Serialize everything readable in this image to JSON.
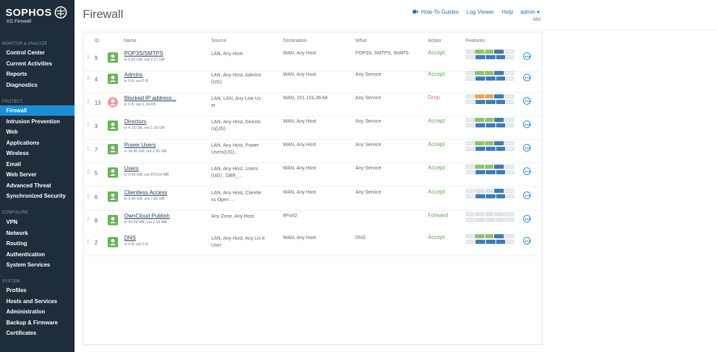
{
  "brand": {
    "name": "SOPHOS",
    "product": "XG Firewall"
  },
  "sidebar": {
    "sections": [
      {
        "title": "MONITOR & ANALYZE",
        "items": [
          "Control Center",
          "Current Activities",
          "Reports",
          "Diagnostics"
        ]
      },
      {
        "title": "PROTECT",
        "items": [
          "Firewall",
          "Intrusion Prevention",
          "Web",
          "Applications",
          "Wireless",
          "Email",
          "Web Server",
          "Advanced Threat",
          "Synchronized Security"
        ]
      },
      {
        "title": "CONFIGURE",
        "items": [
          "VPN",
          "Network",
          "Routing",
          "Authentication",
          "System Services"
        ]
      },
      {
        "title": "SYSTEM",
        "items": [
          "Profiles",
          "Hosts and Services",
          "Administration",
          "Backup & Firmware",
          "Certificates"
        ]
      }
    ],
    "active": "Firewall"
  },
  "header": {
    "title": "Firewall",
    "howto": "How-To Guides",
    "logviewer": "Log Viewer",
    "help": "Help",
    "admin": "admin ▾",
    "admin_sub": "Alsi"
  },
  "table": {
    "columns": {
      "id": "ID",
      "name": "Name",
      "source": "Source",
      "destination": "Destination",
      "what": "What",
      "action": "Action",
      "features": "Features"
    },
    "rows": [
      {
        "id": "9",
        "name": "POP3S/SMTPS",
        "sub": "in 5.81 GB, out 2.27 GB",
        "source": "LAN, Any Host",
        "destination": "WAN, Any Host",
        "what": "POP3S, SMTPS, IMAPS",
        "action": "Accept",
        "icon": "share-icon"
      },
      {
        "id": "4",
        "name": "Admins",
        "sub": "in 0 B, out 0 B",
        "source": "LAN, Any Host, Admins (UG)",
        "destination": "WAN, Any Host",
        "what": "Any Service",
        "action": "Accept",
        "icon": "user-icon"
      },
      {
        "id": "13",
        "name": "Blocked IP address...",
        "sub": "in 0 B, out 1.34 KB",
        "source": "LAN, LAN, Any Live Us er",
        "destination": "WAN, 151.101.36.64",
        "what": "Any Service",
        "action": "Drop",
        "icon": "user-icon"
      },
      {
        "id": "3",
        "name": "Directors",
        "sub": "in 4.33 GB, out 1.30 GB",
        "source": "LAN, Any Host, Directo rs(UG)",
        "destination": "WAN, Any Host",
        "what": "Any Service",
        "action": "Accept",
        "icon": "user-icon"
      },
      {
        "id": "7",
        "name": "Power Users",
        "sub": "in 34.80 GB, out 2.81 GB",
        "source": "LAN, Any Host, Power Users(UG)...",
        "destination": "WAN, Any Host",
        "what": "Any Service",
        "action": "Accept",
        "icon": "user-icon"
      },
      {
        "id": "5",
        "name": "Users",
        "sub": "in 6.96 GB, out 870.64 MB",
        "source": "LAN, Any Host, Users (UG) , DBR_...",
        "destination": "WAN, Any Host",
        "what": "Any Service",
        "action": "Accept",
        "icon": "user-icon"
      },
      {
        "id": "6",
        "name": "Clientless Access",
        "sub": "in 9.46 GB, out 7.82 GB",
        "source": "LAN, Any Host, Clientle ss Open ...",
        "destination": "WAN, Any Host",
        "what": "Any Service",
        "action": "Accept",
        "icon": "user-icon"
      },
      {
        "id": "8",
        "name": "OwnCloud Publish",
        "sub": "in 43.59 MB, out 2.59 MB",
        "source": "Any Zone, Any Host",
        "destination": "#Port2",
        "what": "",
        "action": "Forward",
        "icon": "server-icon"
      },
      {
        "id": "2",
        "name": "DNS",
        "sub": "in 0 B, out 0 B",
        "source": "LAN, Any Host, Any Liv e User",
        "destination": "WAN, Any Host",
        "what": "DNS",
        "action": "Accept",
        "icon": "user-icon"
      }
    ]
  },
  "colors": {
    "sidebar": "#1f2d3b",
    "active": "#1a8fd6",
    "accept": "#5aaa49",
    "drop": "#e57373"
  }
}
